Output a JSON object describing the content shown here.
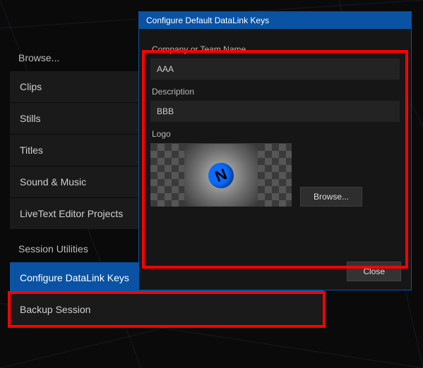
{
  "menu": {
    "browse_label": "Browse...",
    "browse_items": [
      {
        "text": "Clips"
      },
      {
        "text": "Stills"
      },
      {
        "text": "Titles"
      },
      {
        "text": "Sound & Music"
      },
      {
        "text": "LiveText Editor Projects"
      }
    ],
    "utilities_label": "Session Utilities",
    "utilities_items": [
      {
        "text": "Configure DataLink Keys",
        "selected": true
      },
      {
        "text": "Backup Session"
      }
    ]
  },
  "dialog": {
    "title": "Configure Default DataLink Keys",
    "company_label": "Company or Team Name",
    "company_value": "AAA",
    "description_label": "Description",
    "description_value": "BBB",
    "logo_label": "Logo",
    "browse_button": "Browse...",
    "close_button": "Close",
    "logo_glyph": "N"
  }
}
